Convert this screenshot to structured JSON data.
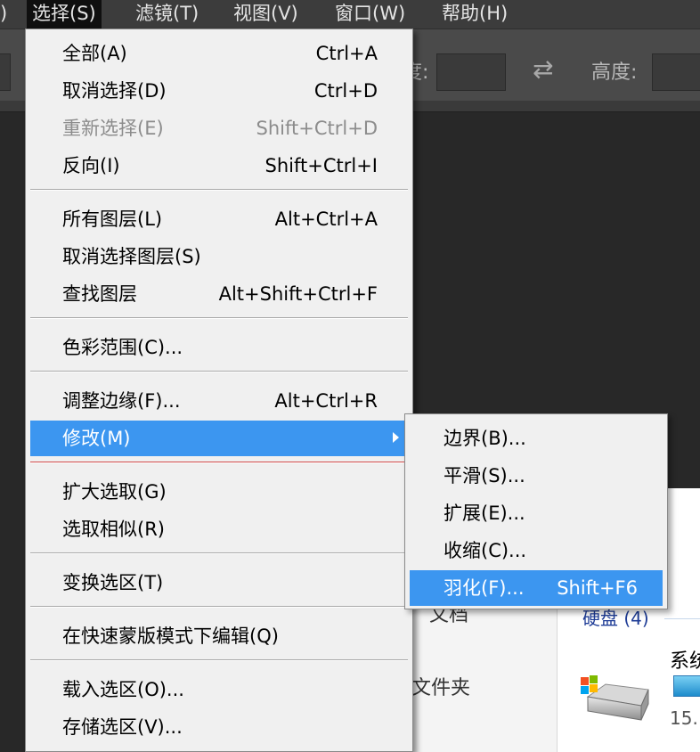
{
  "menubar": {
    "items": [
      {
        "label": ")"
      },
      {
        "label": "选择(S)"
      },
      {
        "label": "滤镜(T)"
      },
      {
        "label": "视图(V)"
      },
      {
        "label": "窗口(W)"
      },
      {
        "label": "帮助(H)"
      }
    ]
  },
  "options_bar": {
    "field_label": "度:",
    "height_label": "高度:"
  },
  "select_menu": {
    "items": [
      {
        "label": "全部(A)",
        "shortcut": "Ctrl+A"
      },
      {
        "label": "取消选择(D)",
        "shortcut": "Ctrl+D"
      },
      {
        "label": "重新选择(E)",
        "shortcut": "Shift+Ctrl+D",
        "disabled": true
      },
      {
        "label": "反向(I)",
        "shortcut": "Shift+Ctrl+I"
      },
      {
        "label": "所有图层(L)",
        "shortcut": "Alt+Ctrl+A"
      },
      {
        "label": "取消选择图层(S)",
        "shortcut": ""
      },
      {
        "label": "查找图层",
        "shortcut": "Alt+Shift+Ctrl+F"
      },
      {
        "label": "色彩范围(C)...",
        "shortcut": ""
      },
      {
        "label": "调整边缘(F)...",
        "shortcut": "Alt+Ctrl+R"
      },
      {
        "label": "修改(M)",
        "shortcut": "",
        "submenu": true,
        "highlighted": true
      },
      {
        "label": "扩大选取(G)",
        "shortcut": ""
      },
      {
        "label": "选取相似(R)",
        "shortcut": ""
      },
      {
        "label": "变换选区(T)",
        "shortcut": ""
      },
      {
        "label": "在快速蒙版模式下编辑(Q)",
        "shortcut": ""
      },
      {
        "label": "载入选区(O)...",
        "shortcut": ""
      },
      {
        "label": "存储选区(V)...",
        "shortcut": ""
      }
    ]
  },
  "modify_submenu": {
    "items": [
      {
        "label": "边界(B)...",
        "shortcut": ""
      },
      {
        "label": "平滑(S)...",
        "shortcut": ""
      },
      {
        "label": "扩展(E)...",
        "shortcut": ""
      },
      {
        "label": "收缩(C)...",
        "shortcut": ""
      },
      {
        "label": "羽化(F)...",
        "shortcut": "Shift+F6",
        "highlighted": true
      }
    ]
  },
  "background_window": {
    "text1": "文档",
    "text2": "文件夹",
    "drives_header": "硬盘 (4)",
    "drive_name": "系统",
    "drive_size": "15."
  },
  "colors": {
    "highlight": "#3c96f0",
    "menu_bg": "#f0f0f0",
    "menubar_bg": "#3c3c3c",
    "separator_red": "#cf4848"
  }
}
